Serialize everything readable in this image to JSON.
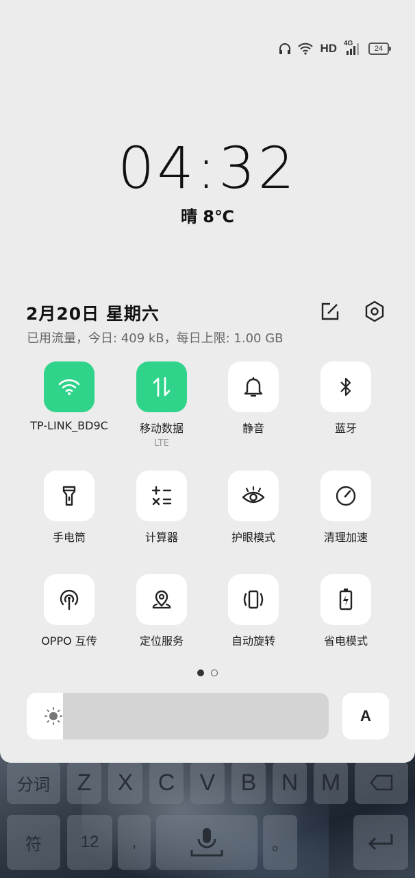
{
  "status_bar": {
    "icons": [
      "headphones-icon",
      "wifi-icon",
      "signal-4g-icon",
      "battery-icon"
    ],
    "hd": "HD",
    "network": "4G",
    "battery": "24"
  },
  "lock": {
    "time": "04:32",
    "weather": "晴 8℃"
  },
  "header": {
    "date": "2月20日  星期六",
    "data_usage": "已用流量，今日: 409 kB，每日上限: 1.00 GB",
    "icons": [
      "edit-icon",
      "settings-icon"
    ]
  },
  "tiles": [
    {
      "label": "TP-LINK_BD9C",
      "icon": "wifi-icon",
      "active": true
    },
    {
      "label": "移动数据",
      "sub": "LTE",
      "icon": "mobile-data-icon",
      "active": true
    },
    {
      "label": "静音",
      "icon": "bell-icon",
      "active": false
    },
    {
      "label": "蓝牙",
      "icon": "bluetooth-icon",
      "active": false
    },
    {
      "label": "手电筒",
      "icon": "flashlight-icon",
      "active": false
    },
    {
      "label": "计算器",
      "icon": "calculator-icon",
      "active": false
    },
    {
      "label": "护眼模式",
      "icon": "eye-icon",
      "active": false
    },
    {
      "label": "清理加速",
      "icon": "speedometer-icon",
      "active": false
    },
    {
      "label": "OPPO 互传",
      "icon": "share-antenna-icon",
      "active": false
    },
    {
      "label": "定位服务",
      "icon": "location-icon",
      "active": false
    },
    {
      "label": "自动旋转",
      "icon": "rotate-icon",
      "active": false
    },
    {
      "label": "省电模式",
      "icon": "battery-saver-icon",
      "active": false
    }
  ],
  "pager": {
    "pages": 2,
    "current": 1
  },
  "brightness": {
    "level": 0.12,
    "auto_label": "A"
  },
  "keyboard": {
    "row1": [
      "分词",
      "Z",
      "X",
      "C",
      "V",
      "B",
      "N",
      "M"
    ],
    "row2": [
      "符",
      "12",
      ",",
      "。"
    ]
  },
  "colors": {
    "accent": "#2fd48a",
    "panel": "#ececec",
    "tile": "#ffffff"
  }
}
